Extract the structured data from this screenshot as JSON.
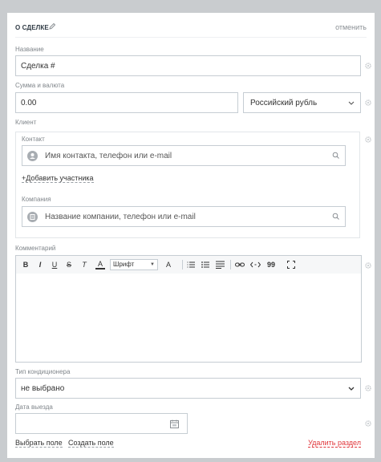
{
  "section": {
    "title": "О СДЕЛКЕ",
    "cancel": "отменить"
  },
  "fields": {
    "name_label": "Название",
    "name_value": "Сделка #",
    "amount_label": "Сумма и валюта",
    "amount_value": "0.00",
    "currency_value": "Российский рубль",
    "client_label": "Клиент",
    "contact_label": "Контакт",
    "contact_placeholder": "Имя контакта, телефон или e-mail",
    "add_participant": "+Добавить участника",
    "company_label": "Компания",
    "company_placeholder": "Название компании, телефон или e-mail",
    "comment_label": "Комментарий",
    "ac_type_label": "Тип кондиционера",
    "ac_type_value": "не выбрано",
    "departure_label": "Дата выезда",
    "departure_value": ""
  },
  "toolbar": {
    "bold": "B",
    "italic": "I",
    "underline": "U",
    "strike": "S",
    "clear_format": "T",
    "font_color": "A",
    "font_family": "Шрифт",
    "font_size": "A",
    "quote": "99"
  },
  "footer": {
    "select_field": "Выбрать поле",
    "create_field": "Создать поле",
    "delete_section": "Удалить раздел"
  },
  "colors": {
    "danger": "#e0353a",
    "border": "#c6cdd3",
    "background": "#c9cccf"
  }
}
